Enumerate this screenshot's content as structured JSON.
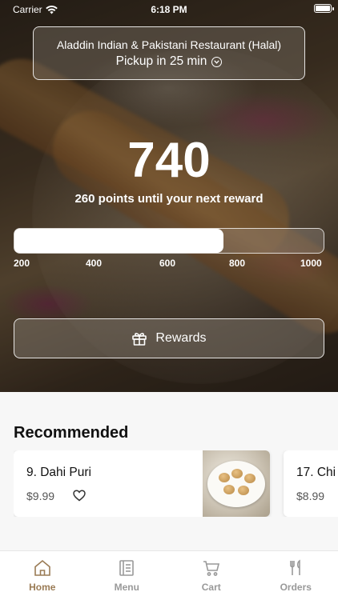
{
  "status_bar": {
    "carrier": "Carrier",
    "time": "6:18 PM"
  },
  "restaurant": {
    "name": "Aladdin Indian & Pakistani Restaurant (Halal)",
    "pickup": "Pickup in 25 min"
  },
  "points": {
    "value": "740",
    "subtitle": "260 points until your next reward",
    "progress_value": 740,
    "progress_min": 200,
    "progress_max": 1000
  },
  "progress_ticks": [
    "200",
    "400",
    "600",
    "800",
    "1000"
  ],
  "rewards_button": {
    "label": "Rewards",
    "icon": "gift-icon"
  },
  "recommended": {
    "title": "Recommended",
    "items": [
      {
        "name": "9. Dahi Puri",
        "price": "$9.99",
        "icon": "heart-icon"
      },
      {
        "name": "17. Chi",
        "price": "$8.99"
      }
    ]
  },
  "tabbar": {
    "items": [
      {
        "label": "Home",
        "icon": "home-icon",
        "active": true
      },
      {
        "label": "Menu",
        "icon": "menu-icon"
      },
      {
        "label": "Cart",
        "icon": "cart-icon"
      },
      {
        "label": "Orders",
        "icon": "fork-knife-icon"
      }
    ]
  },
  "colors": {
    "accent": "#9a7b55",
    "inactive": "#999999"
  }
}
